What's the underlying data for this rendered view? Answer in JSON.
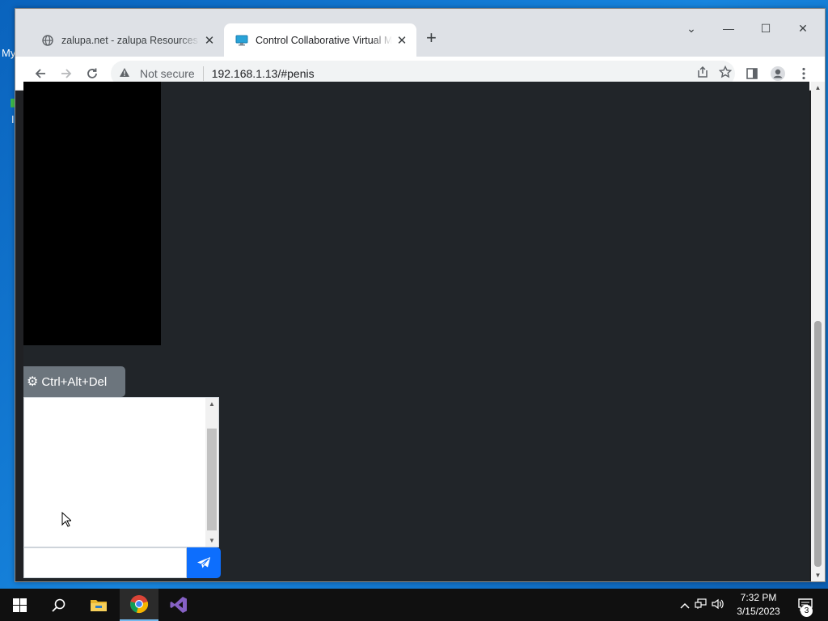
{
  "desktop": {
    "label_fragment": "My",
    "glyph_fragment": "I"
  },
  "browser": {
    "tabs": [
      {
        "title": "zalupa.net - zalupa Resources and",
        "icon": "globe-icon",
        "active": false
      },
      {
        "title": "Control Collaborative Virtual Machine",
        "icon": "monitor-icon",
        "active": true
      }
    ],
    "new_tab_label": "+",
    "window_controls": {
      "tab_search": "⌄",
      "minimize": "—",
      "maximize": "☐",
      "close": "✕"
    },
    "security_text": "Not secure",
    "url": "192.168.1.13/#penis"
  },
  "vm": {
    "cad_button_label": "Ctrl+Alt+Del",
    "chat_input_value": "",
    "send_icon": "paper-plane-icon"
  },
  "taskbar": {
    "pinned": [
      "windows-start-icon",
      "search-icon",
      "file-explorer-icon",
      "chrome-icon",
      "visual-studio-icon"
    ],
    "active_app": "chrome-icon",
    "time": "7:32 PM",
    "date": "3/15/2023",
    "notification_count": "3"
  }
}
